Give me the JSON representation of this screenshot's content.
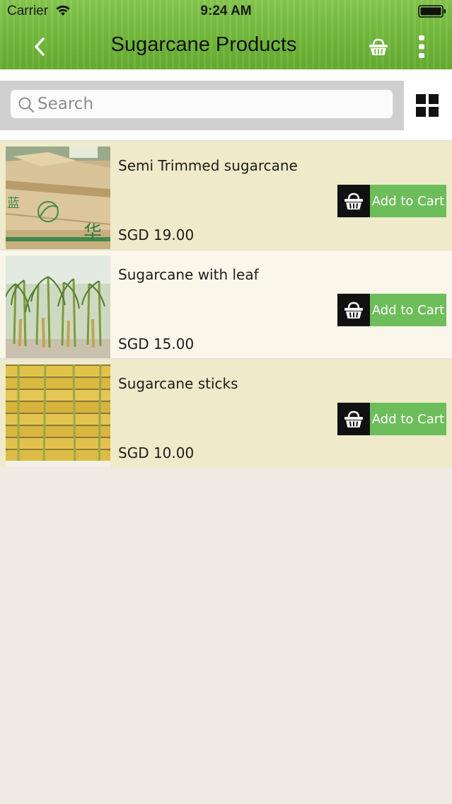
{
  "status_bar": {
    "carrier": "Carrier",
    "time": "9:24 AM",
    "wifi_icon": "wifi-icon",
    "battery_icon": "battery-icon"
  },
  "header": {
    "title": "Sugarcane Products",
    "back_icon": "chevron-left-icon",
    "cart_icon": "basket-icon",
    "more_icon": "more-vertical-icon",
    "background_color": "#73b93c"
  },
  "search": {
    "placeholder": "Search",
    "value": "",
    "icon": "search-icon",
    "view_toggle_icon": "grid-icon"
  },
  "products": [
    {
      "name": "Semi Trimmed sugarcane",
      "price": "SGD 19.00",
      "button_label": "Add to Cart",
      "image": "boxes-of-sugarcane"
    },
    {
      "name": "Sugarcane with leaf",
      "price": "SGD 15.00",
      "button_label": "Add to Cart",
      "image": "sugarcane-field"
    },
    {
      "name": "Sugarcane sticks",
      "price": "SGD 10.00",
      "button_label": "Add to Cart",
      "image": "sugarcane-stick-pile"
    }
  ],
  "colors": {
    "row_odd": "#efeac9",
    "row_even": "#faf6ea",
    "cart_button": "#6dbd5a",
    "cart_icon_bg": "#111111",
    "page_bg": "#efeae2"
  }
}
